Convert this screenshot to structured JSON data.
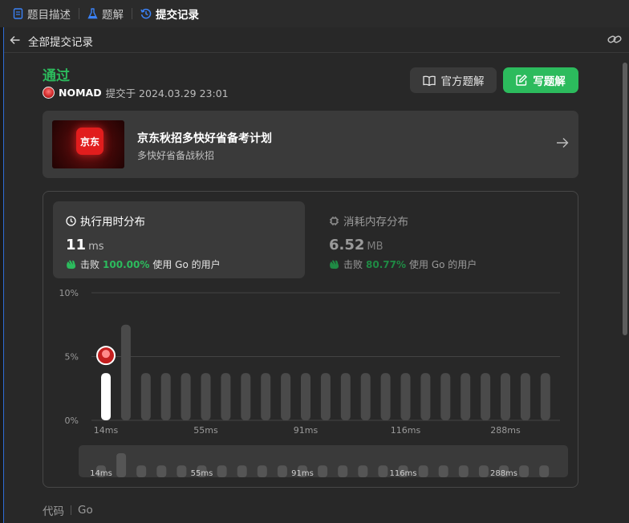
{
  "tabs": [
    {
      "label": "题目描述",
      "icon": "doc-icon"
    },
    {
      "label": "题解",
      "icon": "flask-icon"
    },
    {
      "label": "提交记录",
      "icon": "history-icon",
      "active": true
    }
  ],
  "header": {
    "back_label": "全部提交记录"
  },
  "submission": {
    "status": "通过",
    "username": "NOMAD",
    "submitted_text": "提交于 2024.03.29 23:01",
    "official_solution_label": "官方题解",
    "write_solution_label": "写题解"
  },
  "promo": {
    "logo_text": "京东",
    "title": "京东秋招多快好省备考计划",
    "subtitle": "多快好省备战秋招"
  },
  "runtime": {
    "title": "执行用时分布",
    "value": "11",
    "unit": "ms",
    "beat_label": "击败",
    "beat_pct": "100.00%",
    "beat_suffix": "使用 Go 的用户"
  },
  "memory": {
    "title": "消耗内存分布",
    "value": "6.52",
    "unit": "MB",
    "beat_label": "击败",
    "beat_pct": "80.77%",
    "beat_suffix": "使用 Go 的用户"
  },
  "chart_data": {
    "type": "bar",
    "categories": [
      "14ms",
      "",
      "",
      "",
      "",
      "55ms",
      "",
      "",
      "",
      "",
      "91ms",
      "",
      "",
      "",
      "",
      "116ms",
      "",
      "",
      "",
      "",
      "288ms",
      "",
      ""
    ],
    "values": [
      3.7,
      7.5,
      3.7,
      3.7,
      3.7,
      3.7,
      3.7,
      3.7,
      3.7,
      3.7,
      3.7,
      3.7,
      3.7,
      3.7,
      3.7,
      3.7,
      3.7,
      3.7,
      3.7,
      3.7,
      3.7,
      3.7,
      3.7
    ],
    "highlight_index": 0,
    "yticks": [
      "0%",
      "5%",
      "10%"
    ],
    "ylim": [
      0,
      10
    ],
    "grid": true
  },
  "footer": {
    "code_label": "代码",
    "language": "Go"
  },
  "colors": {
    "accent_green": "#2cbb5d",
    "highlight_bar": "#ffffff",
    "bar": "#4a4a4a"
  }
}
